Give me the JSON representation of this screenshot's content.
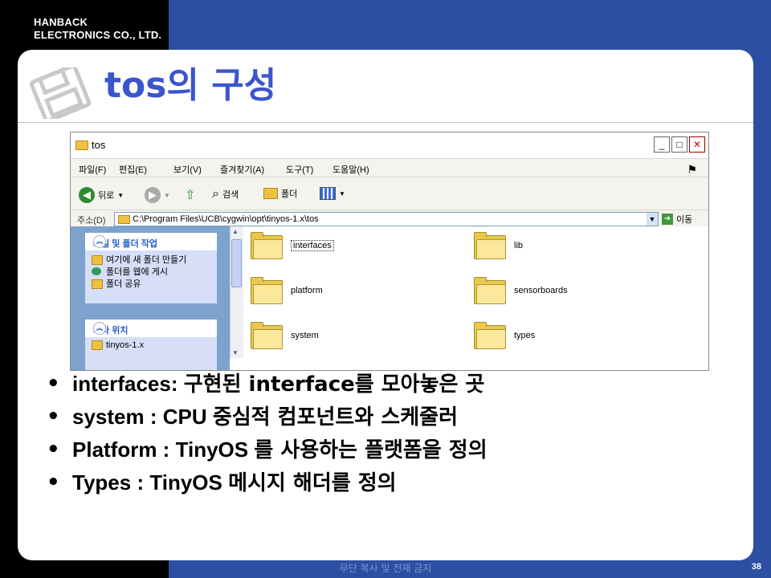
{
  "brand": {
    "line1": "HANBACK",
    "line2": "ELECTRONICS CO., LTD."
  },
  "slide": {
    "title": "tos의 구성",
    "footer": "무단 복사 및 전재 금지",
    "page_number": "38"
  },
  "window": {
    "title": "tos",
    "menu": [
      "파일(F)",
      "편집(E)",
      "보기(V)",
      "즐겨찾기(A)",
      "도구(T)",
      "도움말(H)"
    ],
    "toolbar": {
      "back": "뒤로",
      "search": "검색",
      "folders": "폴더"
    },
    "address": {
      "label": "주소(D)",
      "path": "C:\\Program Files\\UCB\\cygwin\\opt\\tinyos-1.x\\tos",
      "go": "이동"
    },
    "tasks": {
      "title": "파일 및 폴더 작업",
      "items": [
        "여기에 새 폴더 만들기",
        "폴더를 웹에 게시",
        "폴더 공유"
      ]
    },
    "other_places": {
      "title": "기타 위치",
      "items": [
        "tinyos-1.x"
      ]
    },
    "folders": [
      "interfaces",
      "lib",
      "platform",
      "sensorboards",
      "system",
      "types"
    ]
  },
  "bullets": [
    {
      "en": "interfaces: ",
      "ko": "구현된 interface를 모아놓은 곳"
    },
    {
      "en": "system : CPU ",
      "ko": "중심적 컴포넌트와 스케줄러"
    },
    {
      "en": "Platform : TinyOS ",
      "ko": "를 사용하는 플랫폼을 정의"
    },
    {
      "en": "Types : TinyOS ",
      "ko": "메시지 해더를 정의"
    }
  ]
}
